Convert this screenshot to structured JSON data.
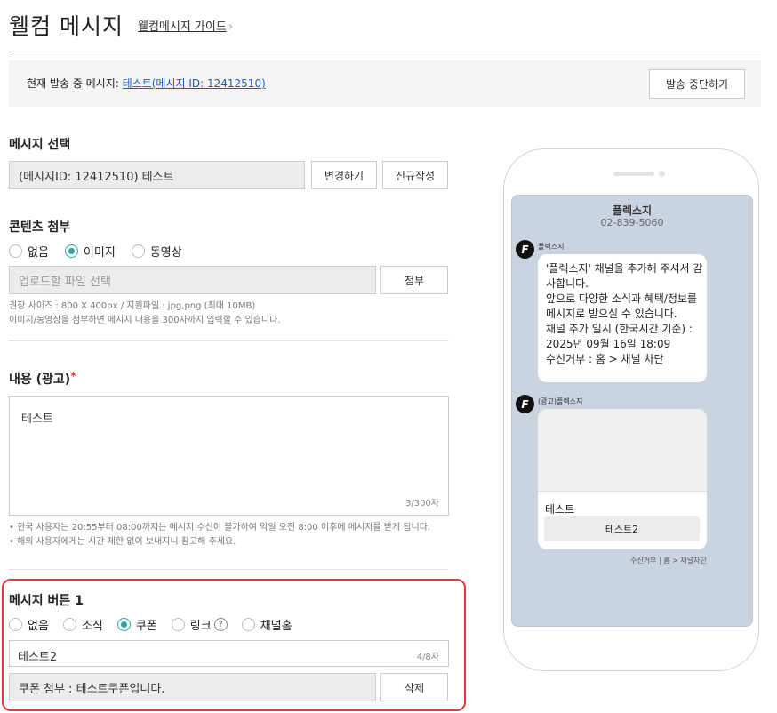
{
  "header": {
    "title": "웰컴 메시지",
    "guide_link": "웰컴메시지 가이드",
    "guide_chevron": "›"
  },
  "status": {
    "label": "현재 발송 중 메시지: ",
    "current_message": "테스트(메시지 ID: 12412510)",
    "stop_button": "발송 중단하기"
  },
  "message_select": {
    "label": "메시지 선택",
    "value": "(메시지ID: 12412510) 테스트",
    "change_button": "변경하기",
    "new_button": "신규작성"
  },
  "content_attach": {
    "label": "콘텐츠 첨부",
    "options": [
      {
        "label": "없음",
        "selected": false
      },
      {
        "label": "이미지",
        "selected": true
      },
      {
        "label": "동영상",
        "selected": false
      }
    ],
    "file_placeholder": "업로드할 파일 선택",
    "attach_button": "첨부",
    "help_lines": [
      "권장 사이즈 : 800 X 400px / 지원파일 : jpg,png (최대 10MB)",
      "이미지/동영상을 첨부하면 메시지 내용을 300자까지 입력할 수 있습니다."
    ]
  },
  "body": {
    "label": "내용 (광고)",
    "required_mark": "*",
    "value": "테스트",
    "counter": "3/300자",
    "notes": [
      "• 한국 사용자는 20:55부터 08:00까지는 메시지 수신이 불가하여 익일 오전 8:00 이후에 메시지를 받게 됩니다.",
      "• 해외 사용자에게는 시간 제한 없이 보내지니 참고해 주세요."
    ]
  },
  "button1": {
    "label": "메시지 버튼 1",
    "options": [
      {
        "label": "없음",
        "selected": false
      },
      {
        "label": "소식",
        "selected": false
      },
      {
        "label": "쿠폰",
        "selected": true
      },
      {
        "label": "링크",
        "selected": false
      },
      {
        "label": "채널홈",
        "selected": false
      }
    ],
    "help_glyph": "?",
    "name_value": "테스트2",
    "name_counter": "4/8자",
    "coupon_value": "쿠폰 첨부 : 테스트쿠폰입니다.",
    "delete_button": "삭제"
  },
  "preview": {
    "channel_name": "플렉스지",
    "channel_phone": "02-839-5060",
    "profile_glyph": "F",
    "sender1": "플렉스지",
    "welcome_lines": [
      "'플렉스지' 채널을 추가해 주셔서 감",
      "사합니다.",
      "앞으로 다양한 소식과 혜택/정보를",
      "메시지로 받으실 수 있습니다.",
      "",
      "채널 추가 일시 (한국시간 기준) :",
      "2025년 09월 16일 18:09",
      "수신거부 : 홈 > 채널 차단"
    ],
    "sender2": "(광고)플렉스지",
    "card_title": "테스트",
    "card_button": "테스트2",
    "optout": "수신거부 | 홈 > 채널차단"
  },
  "colors": {
    "accent": "#2aa6a6",
    "highlight": "#e2393b",
    "link": "#1a5fbf",
    "preview_bg": "#cad3e0"
  }
}
